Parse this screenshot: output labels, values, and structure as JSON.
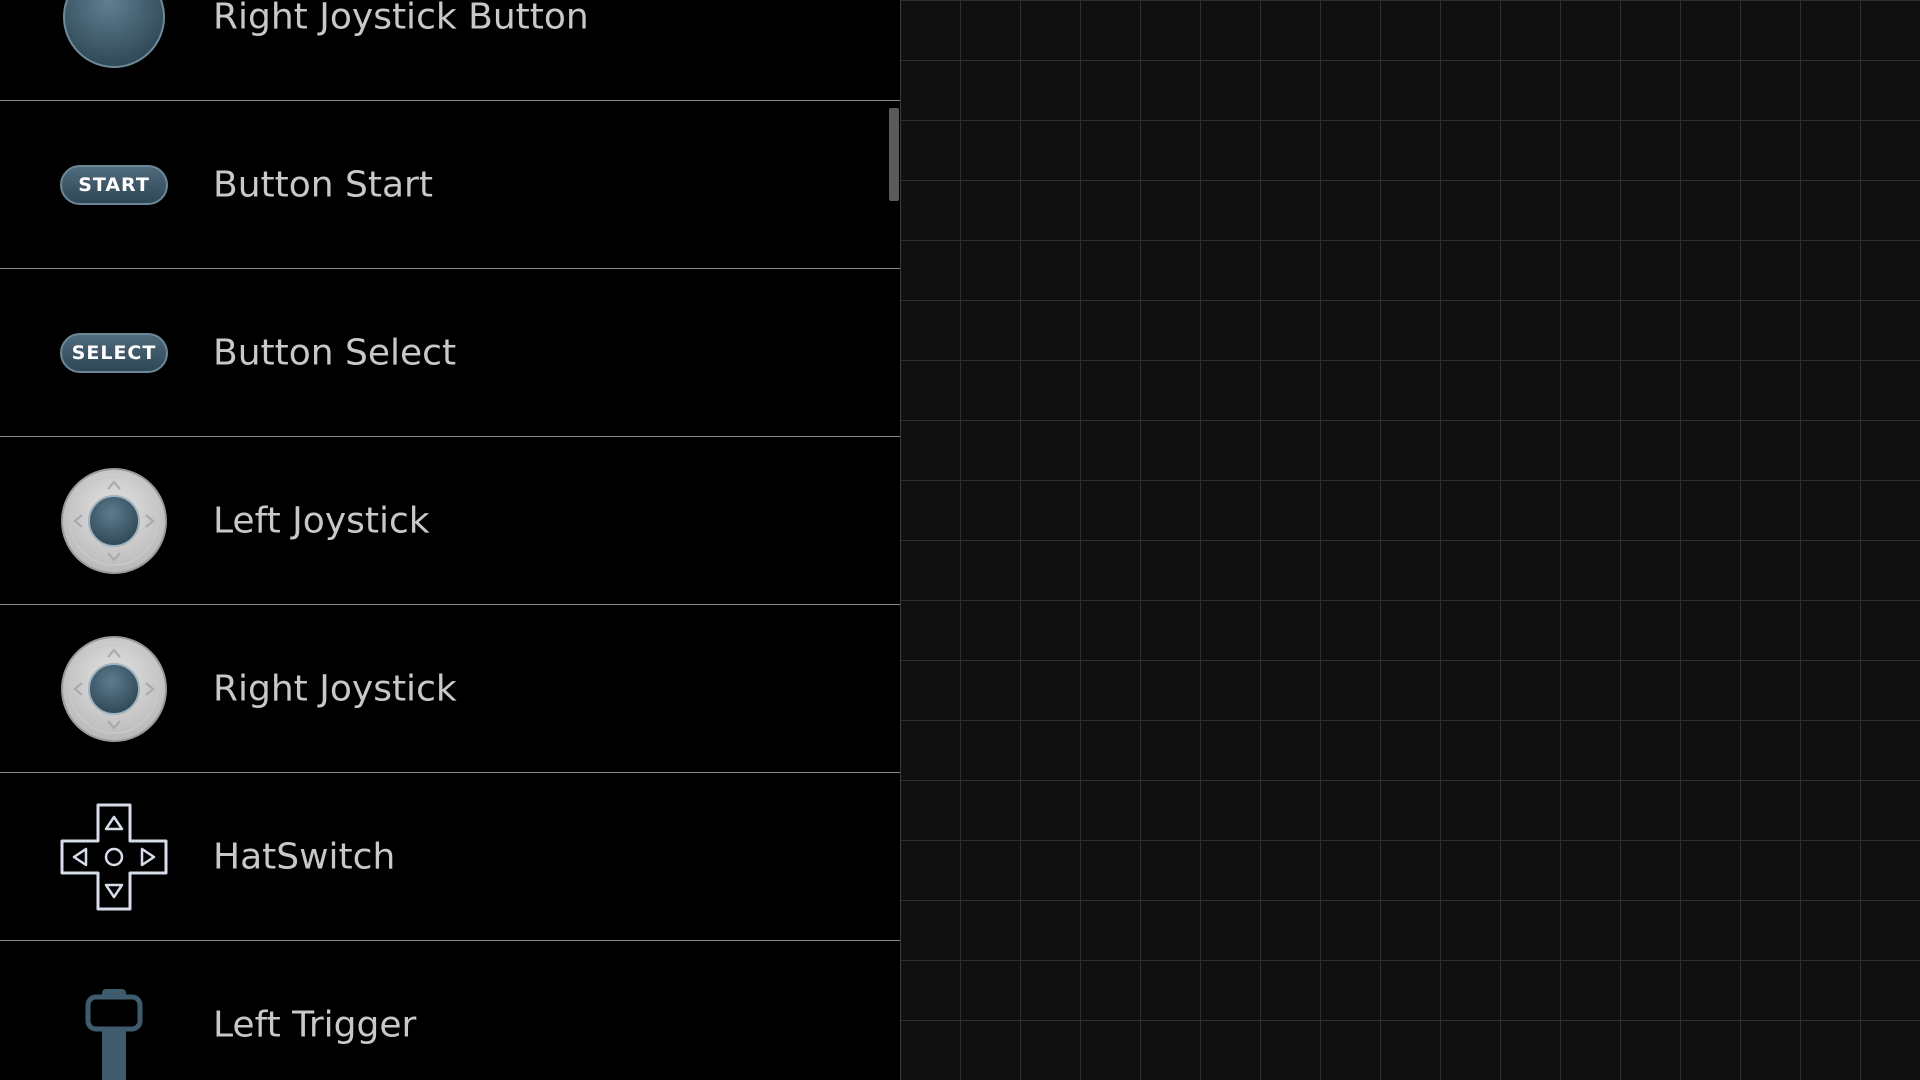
{
  "controls": [
    {
      "id": "right-joystick-button",
      "label": "Right Joystick Button",
      "icon": "joystick-button-icon"
    },
    {
      "id": "button-start",
      "label": "Button Start",
      "icon": "start-button-icon",
      "pill_text": "START"
    },
    {
      "id": "button-select",
      "label": "Button Select",
      "icon": "select-button-icon",
      "pill_text": "SELECT"
    },
    {
      "id": "left-joystick",
      "label": "Left Joystick",
      "icon": "joystick-icon"
    },
    {
      "id": "right-joystick",
      "label": "Right Joystick",
      "icon": "joystick-icon"
    },
    {
      "id": "hatswitch",
      "label": "HatSwitch",
      "icon": "dpad-icon"
    },
    {
      "id": "left-trigger",
      "label": "Left Trigger",
      "icon": "trigger-icon"
    }
  ],
  "colors": {
    "background": "#000000",
    "label_text": "#c8c8c8",
    "accent_blue": "#3f5c6e",
    "joystick_base": "#d4d4d4",
    "grid_line": "#2f2f2f",
    "grid_bg": "#101010"
  }
}
